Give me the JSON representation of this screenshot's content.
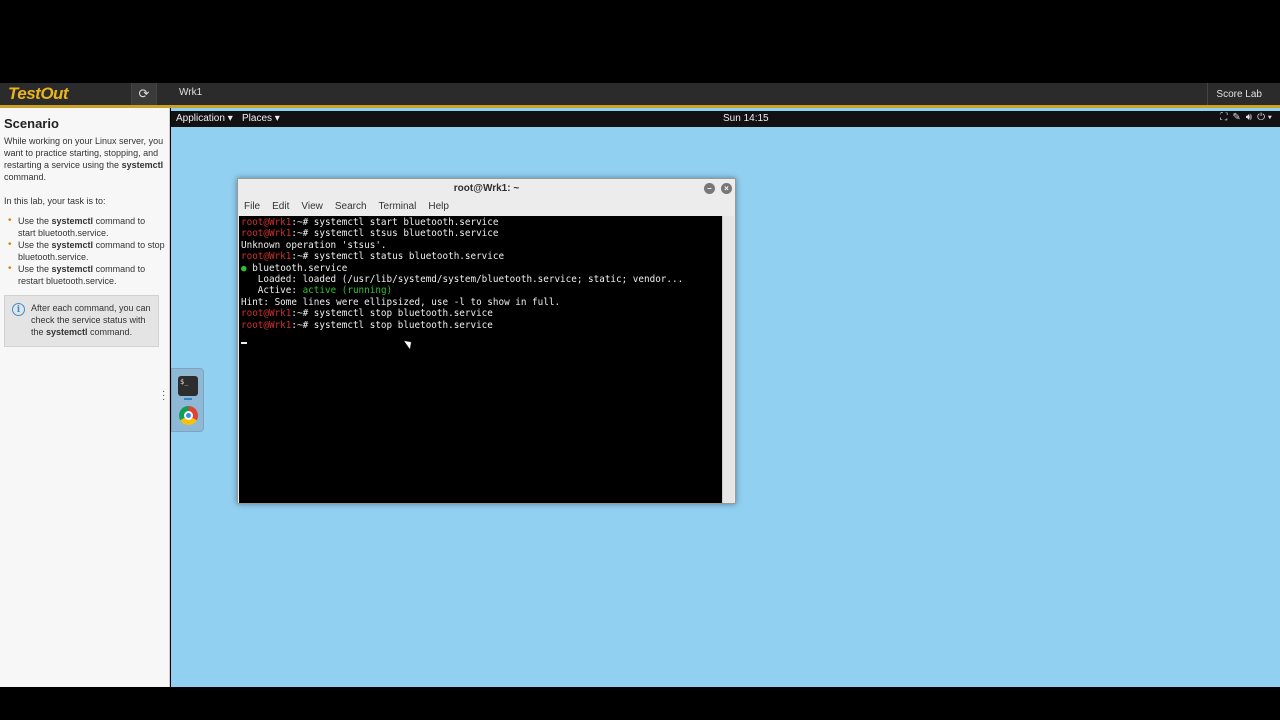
{
  "header": {
    "logo": "TestOut",
    "refresh_icon": "refresh-icon",
    "machine": "Wrk1",
    "score_button": "Score Lab"
  },
  "sidebar": {
    "title": "Scenario",
    "intro_a": "While working on your Linux server, you want to practice starting, stopping, and restarting a service using the ",
    "intro_cmd": "systemctl",
    "intro_b": " command.",
    "task_intro": "In this lab, your task is to:",
    "tasks": [
      {
        "a": "Use the ",
        "cmd": "systemctl",
        "b": " command to start bluetooth.service."
      },
      {
        "a": "Use the ",
        "cmd": "systemctl",
        "b": " command to stop bluetooth.service."
      },
      {
        "a": "Use the ",
        "cmd": "systemctl",
        "b": " command to restart bluetooth.service."
      }
    ],
    "tip_icon": "info-icon",
    "tip_a": "After each command, you can check the service status with the ",
    "tip_cmd": "systemctl",
    "tip_b": " command."
  },
  "desktop": {
    "menus": [
      "Application ▾",
      "Places ▾"
    ],
    "clock": "Sun 14:15",
    "tray_icons": [
      "network-icon",
      "pen-icon",
      "volume-icon",
      "power-icon"
    ]
  },
  "dock": {
    "apps": [
      "terminal-icon",
      "chrome-icon"
    ]
  },
  "terminal": {
    "title": "root@Wrk1: ~",
    "menu": [
      "File",
      "Edit",
      "View",
      "Search",
      "Terminal",
      "Help"
    ],
    "prompt": "root@Wrk1",
    "lines": [
      {
        "type": "cmd",
        "text": ":~# systemctl start bluetooth.service"
      },
      {
        "type": "cmd",
        "text": ":~# systemctl stsus bluetooth.service"
      },
      {
        "type": "out",
        "text": "Unknown operation 'stsus'."
      },
      {
        "type": "cmd",
        "text": ":~# systemctl status bluetooth.service"
      },
      {
        "type": "svc",
        "text": "bluetooth.service"
      },
      {
        "type": "out",
        "text": "   Loaded: loaded (/usr/lib/systemd/system/bluetooth.service; static; vendor..."
      },
      {
        "type": "active",
        "label": "   Active: ",
        "text": "active (running)"
      },
      {
        "type": "out",
        "text": "Hint: Some lines were ellipsized, use -l to show in full."
      },
      {
        "type": "cmd",
        "text": ":~# systemctl stop bluetooth.service"
      },
      {
        "type": "cmd",
        "text": ":~# systemctl stop bluetooth.service"
      }
    ]
  }
}
